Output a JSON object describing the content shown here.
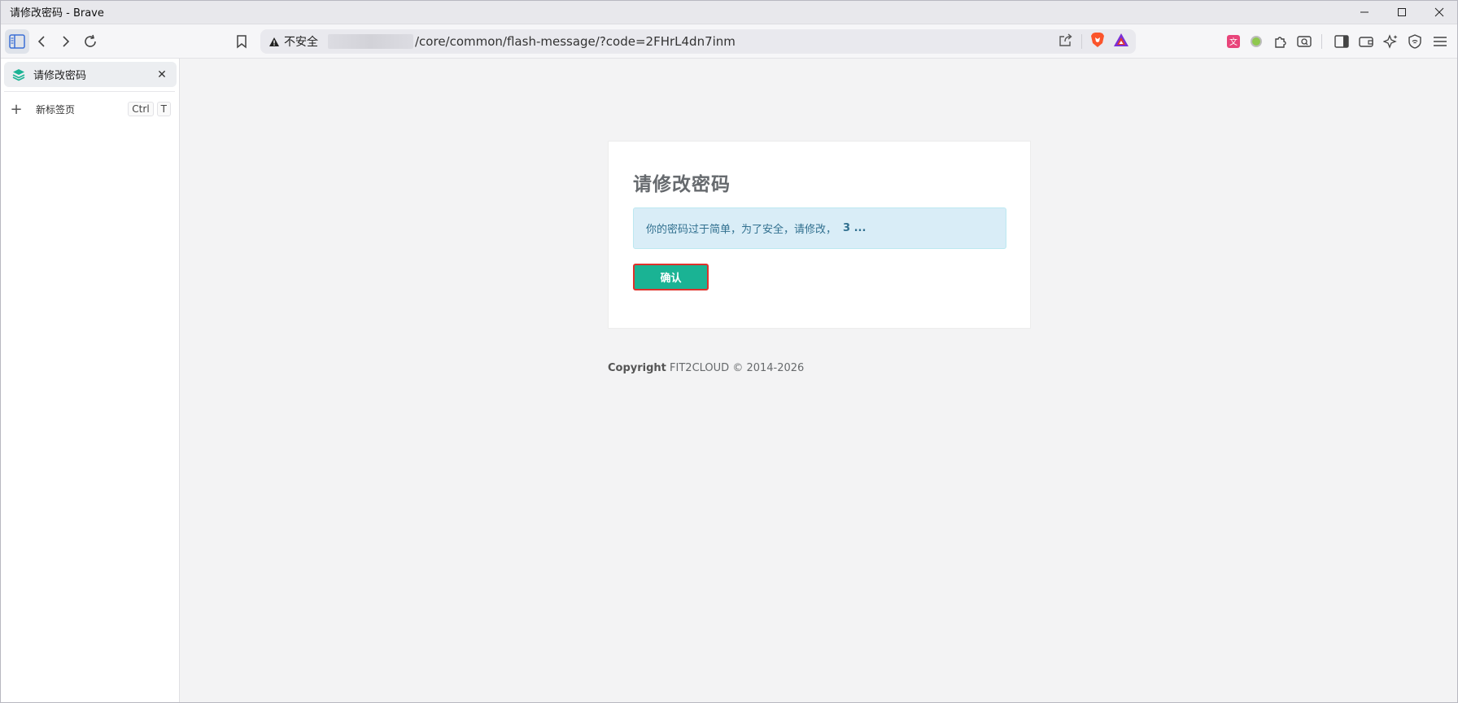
{
  "window": {
    "title": "请修改密码 - Brave"
  },
  "addressbar": {
    "security_label": "不安全",
    "path": "/core/common/flash-message/?code=2FHrL4dn7inm"
  },
  "sidebar": {
    "tab": {
      "label": "请修改密码",
      "close": "✕"
    },
    "new_tab": {
      "label": "新标签页",
      "shortcut_ctrl": "Ctrl",
      "shortcut_key": "T"
    }
  },
  "page": {
    "heading": "请修改密码",
    "message": "你的密码过于简单，为了安全，请修改，",
    "countdown": "3 ...",
    "confirm_label": "确认",
    "copyright_brand": "Copyright",
    "copyright_text": "FIT2CLOUD © 2014-2026"
  },
  "colors": {
    "accent": "#1ab394",
    "alert_bg": "#d9edf7",
    "alert_text": "#31708f",
    "highlight_border": "#e0312c"
  },
  "icons": [
    "sidebar-toggle-icon",
    "back-icon",
    "forward-icon",
    "reload-icon",
    "bookmark-icon",
    "warning-icon",
    "share-icon",
    "brave-shields-icon",
    "brave-rewards-icon",
    "translate-extension-icon",
    "green-dot-extension-icon",
    "extensions-icon",
    "screenshot-extension-icon",
    "sidebar-panel-icon",
    "wallet-icon",
    "leo-ai-icon",
    "vpn-icon",
    "menu-icon"
  ]
}
